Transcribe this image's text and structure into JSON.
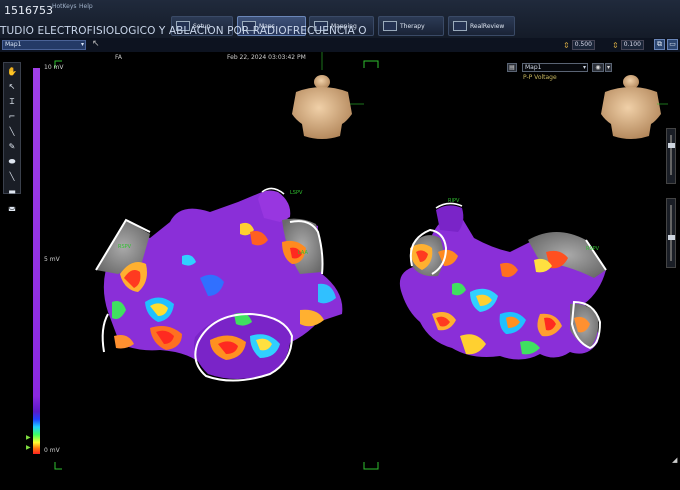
{
  "app": {
    "case_id": "1516753",
    "study_title": "TUDIO ELECTROFISIOLOGICO Y ABLACION POR RADIOFRECUENCIA O",
    "menu": [
      "HotKeys",
      "Help"
    ]
  },
  "mode_tabs": [
    {
      "label": "Setup"
    },
    {
      "label": "Maps"
    },
    {
      "label": "Mapping"
    },
    {
      "label": "Therapy"
    },
    {
      "label": "RealReview"
    }
  ],
  "toolbar2": {
    "map_select": "Map1",
    "spin1": "0.500",
    "spin2": "0.100"
  },
  "viewport": {
    "chamber_label": "FA",
    "timestamp": "Feb 22, 2024 03:03:42 PM",
    "map_dropdown": "Map1",
    "map_type": "P-P Voltage",
    "scale": {
      "top": "10 mV",
      "mid": "5 mV",
      "bottom": "0 mV"
    },
    "markers_left": [
      "RSPV",
      "LSPV",
      "LAA"
    ],
    "markers_right": [
      "RIPV",
      "RSPV"
    ]
  },
  "tools": [
    "hand-icon",
    "pointer-icon",
    "ibeam-icon",
    "segment-icon",
    "line-icon",
    "pen-icon",
    "ellipse-icon",
    "brush-icon",
    "chip-icon",
    "car-icon",
    "curve-icon"
  ]
}
